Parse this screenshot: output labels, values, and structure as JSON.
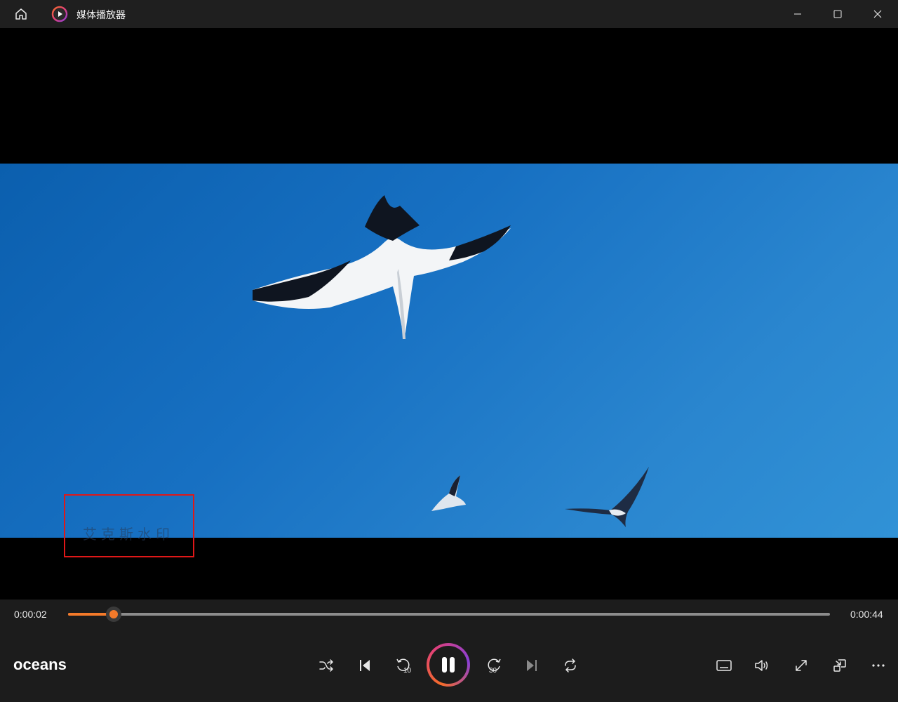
{
  "window": {
    "title": "媒体播放器",
    "icons": {
      "home": "home-icon",
      "app": "media-player-app-icon",
      "minimize": "minimize-icon",
      "maximize": "maximize-icon",
      "close": "close-icon"
    }
  },
  "video": {
    "watermark_text": "艾克斯水印",
    "watermark_highlight_color": "#e01818"
  },
  "playback": {
    "current_time": "0:00:02",
    "duration": "0:00:44",
    "progress_fraction": 0.06,
    "accent_color": "#f47a2a",
    "state": "playing"
  },
  "media": {
    "title": "oceans"
  },
  "controls": {
    "center": [
      "shuffle-icon",
      "previous-icon",
      "rewind-10-icon",
      "pause-icon",
      "forward-30-icon",
      "next-icon",
      "repeat-icon"
    ],
    "rewind_label": "10",
    "forward_label": "30",
    "right": [
      "subtitles-icon",
      "volume-icon",
      "fullscreen-icon",
      "mini-player-icon",
      "more-icon"
    ]
  }
}
